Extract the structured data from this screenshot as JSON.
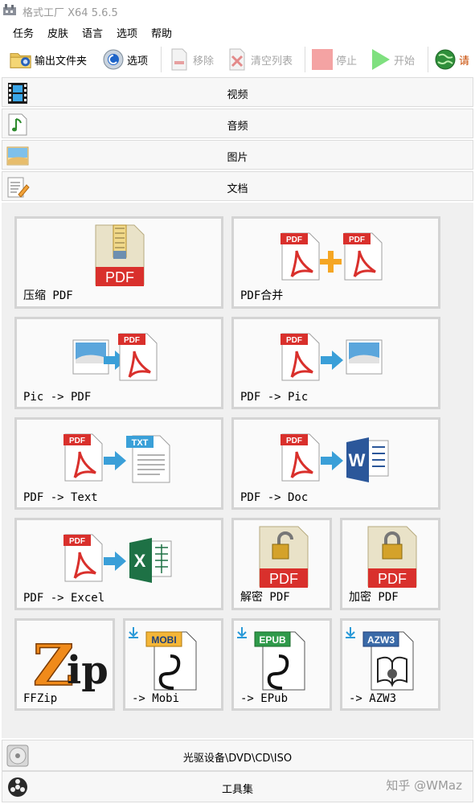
{
  "window": {
    "title": "格式工厂 X64 5.6.5"
  },
  "menu": {
    "task": "任务",
    "skin": "皮肤",
    "language": "语言",
    "options": "选项",
    "help": "帮助"
  },
  "toolbar": {
    "output_folder": "输出文件夹",
    "options": "选项",
    "remove": "移除",
    "clear_list": "清空列表",
    "stop": "停止",
    "start": "开始",
    "login_partial": "请"
  },
  "categories": {
    "video": "视频",
    "audio": "音频",
    "image": "图片",
    "document": "文档"
  },
  "tiles": {
    "compress_pdf": "压缩 PDF",
    "pdf_merge": "PDF合并",
    "pic_to_pdf": "Pic -> PDF",
    "pdf_to_pic": "PDF -> Pic",
    "pdf_to_text": "PDF -> Text",
    "pdf_to_doc": "PDF -> Doc",
    "pdf_to_excel": "PDF -> Excel",
    "decrypt_pdf": "解密 PDF",
    "encrypt_pdf": "加密 PDF",
    "ffzip": "FFZip",
    "to_mobi": "-> Mobi",
    "to_epub": "-> EPub",
    "to_azw3": "-> AZW3"
  },
  "icon_text": {
    "pdf": "PDF",
    "txt": "TXT",
    "word": "W",
    "excel": "X",
    "mobi": "MOBI",
    "epub": "EPUB",
    "azw3": "AZW3",
    "zip_z": "Z",
    "zip_ip": "ip"
  },
  "bottom": {
    "optical": "光驱设备\\DVD\\CD\\ISO",
    "tools": "工具集"
  },
  "watermark": "知乎 @WMaz",
  "colors": {
    "pdf_red": "#d9302c",
    "arrow_blue": "#35a3dc",
    "word_blue": "#2b579a",
    "excel_green": "#1e7145",
    "start_green": "#3cc43c",
    "stop_red": "#f4a3a3"
  }
}
